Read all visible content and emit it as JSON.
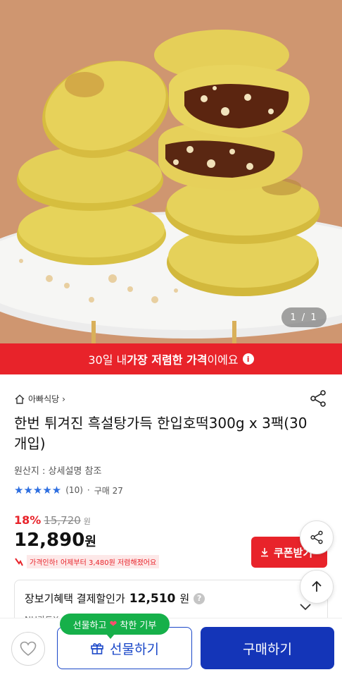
{
  "hero": {
    "image_alt": "",
    "counter": "1 / 1"
  },
  "banner": {
    "prefix": "30일 내 ",
    "highlight": "가장 저렴한 가격",
    "suffix": "이에요"
  },
  "product": {
    "store_name": "아빠식당",
    "title": "한번 튀겨진 흑설탕가득 한입호떡300g x 3팩(30개입)",
    "origin": "원산지 : 상세설명 참조",
    "rating_count": "(10)",
    "purchase_count": "구매 27",
    "discount_rate": "18%",
    "original_price": "15,720",
    "original_unit": "원",
    "sale_price": "12,890",
    "sale_unit": "원",
    "price_drop_note": "가격인하! 어제부터 3,480원 저렴해졌어요",
    "coupon_label": "쿠폰받기"
  },
  "benefit": {
    "label": "장보기혜택 결제할인가",
    "price": "12,510",
    "unit": "원",
    "sub_text": "NH카드X…이상 결제 시 3% 할인"
  },
  "tooltip": {
    "left": "선물하고",
    "right": "착한 기부"
  },
  "bottom": {
    "gift_label": "선물하기",
    "buy_label": "구매하기"
  },
  "colors": {
    "accent_red": "#e8232a",
    "primary_blue": "#1435b8",
    "tooltip_green": "#16b04a",
    "star_blue": "#2d6ee0"
  }
}
